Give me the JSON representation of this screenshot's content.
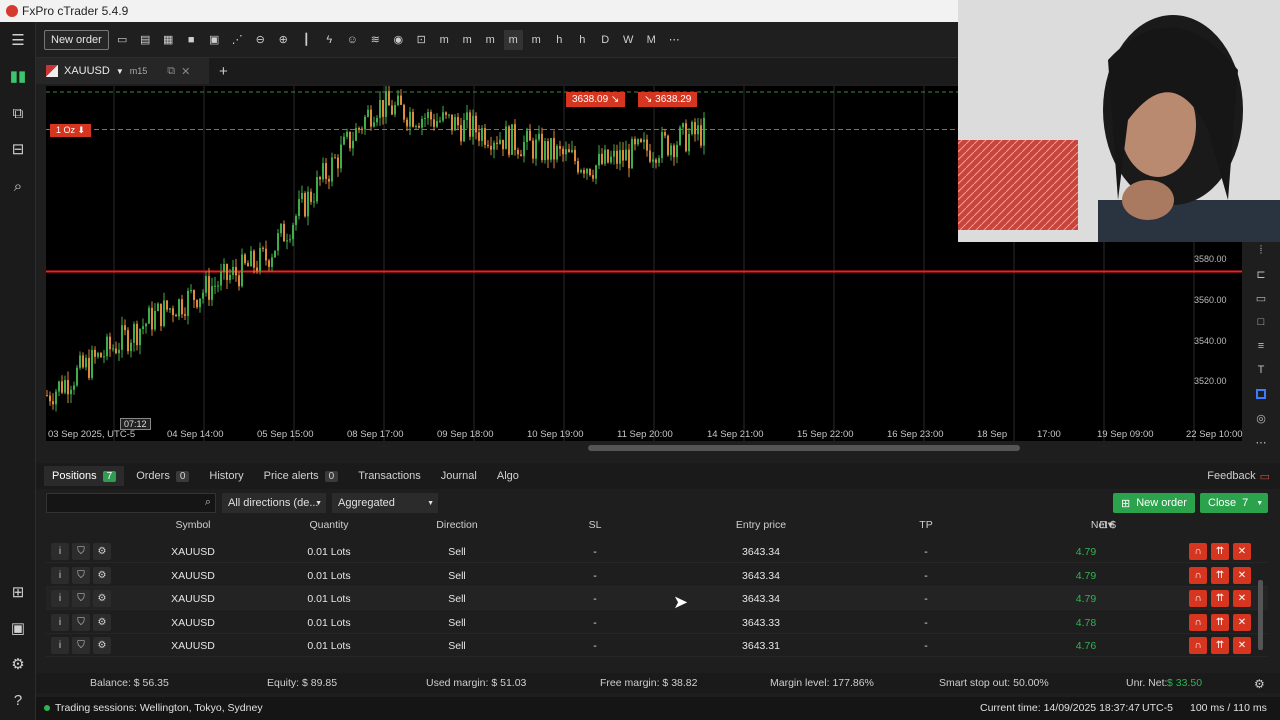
{
  "window": {
    "title": "FxPro cTrader 5.4.9"
  },
  "toolbar": {
    "new_order_label": "New order"
  },
  "chart_tab": {
    "symbol": "XAUUSD",
    "timeframe": "m15"
  },
  "chart": {
    "order_line_label": "1 Oz",
    "sell_price": "3638.09",
    "buy_price": "3638.29",
    "crosshair_time": "07:12",
    "price_ticks": [
      "3580.00",
      "3560.00",
      "3540.00",
      "3520.00"
    ],
    "time_ticks": [
      "03 Sep 2025, UTC-5",
      "04 Sep 14:00",
      "05 Sep 15:00",
      "08 Sep 17:00",
      "09 Sep 18:00",
      "10 Sep 19:00",
      "11 Sep 20:00",
      "14 Sep 21:00",
      "15 Sep 22:00",
      "16 Sep 23:00",
      "18 Sep",
      "17:00",
      "19 Sep 09:00",
      "22 Sep 10:00"
    ]
  },
  "chart_data": {
    "type": "line",
    "title": "",
    "xlabel": "",
    "ylabel": "",
    "x": [
      "03 Sep 2025",
      "04 Sep 14:00",
      "05 Sep 15:00",
      "08 Sep 17:00",
      "09 Sep 18:00",
      "10 Sep 19:00",
      "11 Sep 20:00"
    ],
    "series": [
      {
        "values": [
          3525,
          3560,
          3585,
          3652,
          3640,
          3625,
          3640
        ]
      }
    ],
    "ylim": [
      3505,
      3660
    ],
    "horizontal_lines": [
      3579,
      3641
    ],
    "candle_colors": {
      "up": "#3fae4a",
      "down": "#e08a3c"
    }
  },
  "panel": {
    "tabs": [
      {
        "label": "Positions",
        "count": "7"
      },
      {
        "label": "Orders",
        "count": "0"
      },
      {
        "label": "History",
        "count": ""
      },
      {
        "label": "Price alerts",
        "count": "0"
      },
      {
        "label": "Transactions",
        "count": ""
      },
      {
        "label": "Journal",
        "count": ""
      },
      {
        "label": "Algo",
        "count": ""
      }
    ],
    "feedback_label": "Feedback",
    "filter_direction": "All directions (de...",
    "filter_grouping": "Aggregated",
    "new_order_label": "New order",
    "close_label": "Close",
    "close_count": "7"
  },
  "table": {
    "headers": {
      "symbol": "Symbol",
      "quantity": "Quantity",
      "direction": "Direction",
      "sl": "SL",
      "entry": "Entry price",
      "tp": "TP",
      "net": "Net $"
    },
    "rows": [
      {
        "symbol": "XAUUSD",
        "quantity": "0.01 Lots",
        "direction": "Sell",
        "sl": "-",
        "entry": "3643.34",
        "tp": "-",
        "net": "4.79"
      },
      {
        "symbol": "XAUUSD",
        "quantity": "0.01 Lots",
        "direction": "Sell",
        "sl": "-",
        "entry": "3643.34",
        "tp": "-",
        "net": "4.79"
      },
      {
        "symbol": "XAUUSD",
        "quantity": "0.01 Lots",
        "direction": "Sell",
        "sl": "-",
        "entry": "3643.34",
        "tp": "-",
        "net": "4.79"
      },
      {
        "symbol": "XAUUSD",
        "quantity": "0.01 Lots",
        "direction": "Sell",
        "sl": "-",
        "entry": "3643.33",
        "tp": "-",
        "net": "4.78"
      },
      {
        "symbol": "XAUUSD",
        "quantity": "0.01 Lots",
        "direction": "Sell",
        "sl": "-",
        "entry": "3643.31",
        "tp": "-",
        "net": "4.76"
      }
    ]
  },
  "summary": {
    "balance": "Balance: $ 56.35",
    "equity": "Equity: $ 89.85",
    "used_margin": "Used margin: $ 51.03",
    "free_margin": "Free margin: $ 38.82",
    "margin_level": "Margin level: 177.86%",
    "smart_stop": "Smart stop out: 50.00%",
    "unr_net_label": "Unr. Net:",
    "unr_net_value": "$ 33.50"
  },
  "status": {
    "sessions": "Trading sessions: Wellington, Tokyo, Sydney",
    "current_time": "Current time: 14/09/2025 18:37:47",
    "tz": "UTC-5",
    "latency": "100 ms / 110 ms"
  },
  "colors": {
    "positive": "#2fb54f",
    "accent_red": "#d6351f",
    "green_button": "#2ba24c"
  }
}
